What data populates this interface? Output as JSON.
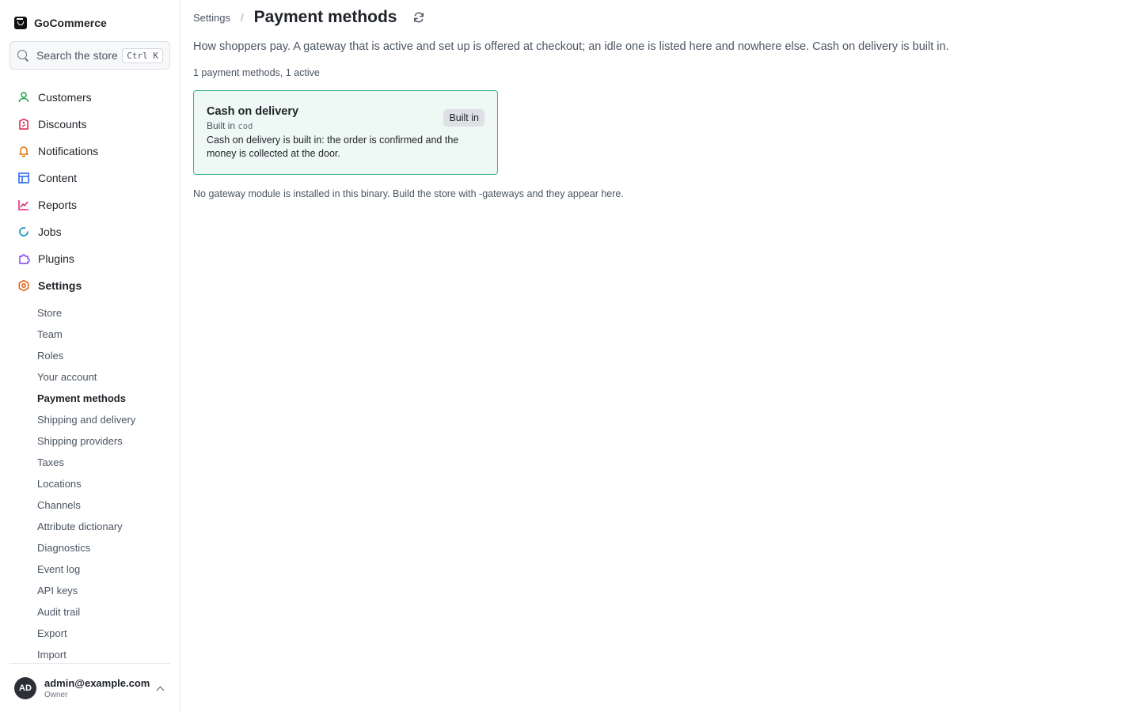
{
  "brand": {
    "name": "GoCommerce"
  },
  "search": {
    "placeholder": "Search the store",
    "shortcut": "Ctrl K"
  },
  "nav": [
    {
      "label": "Customers",
      "icon": "person-icon",
      "color": "#16a34a"
    },
    {
      "label": "Discounts",
      "icon": "tag-icon",
      "color": "#e11d48"
    },
    {
      "label": "Notifications",
      "icon": "bell-icon",
      "color": "#d97706"
    },
    {
      "label": "Content",
      "icon": "layout-icon",
      "color": "#2563eb"
    },
    {
      "label": "Reports",
      "icon": "chart-icon",
      "color": "#db2777"
    },
    {
      "label": "Jobs",
      "icon": "spinner-icon",
      "color": "#0891b2"
    },
    {
      "label": "Plugins",
      "icon": "puzzle-icon",
      "color": "#7c3aed"
    },
    {
      "label": "Settings",
      "icon": "gear-icon",
      "color": "#ea580c"
    }
  ],
  "settings_sub": [
    "Store",
    "Team",
    "Roles",
    "Your account",
    "Payment methods",
    "Shipping and delivery",
    "Shipping providers",
    "Taxes",
    "Locations",
    "Channels",
    "Attribute dictionary",
    "Diagnostics",
    "Event log",
    "API keys",
    "Audit trail",
    "Export",
    "Import"
  ],
  "active_sub": "Payment methods",
  "user": {
    "initials": "AD",
    "email": "admin@example.com",
    "role": "Owner"
  },
  "header": {
    "breadcrumb": "Settings",
    "separator": "/",
    "title": "Payment methods"
  },
  "description": "How shoppers pay. A gateway that is active and set up is offered at checkout; an idle one is listed here and nowhere else. Cash on delivery is built in.",
  "count_text": "1 payment methods, 1 active",
  "card": {
    "title": "Cash on delivery",
    "sub_prefix": "Built in",
    "code": "cod",
    "body": "Cash on delivery is built in: the order is confirmed and the money is collected at the door.",
    "badge": "Built in"
  },
  "note": "No gateway module is installed in this binary. Build the store with -gateways and they appear here."
}
